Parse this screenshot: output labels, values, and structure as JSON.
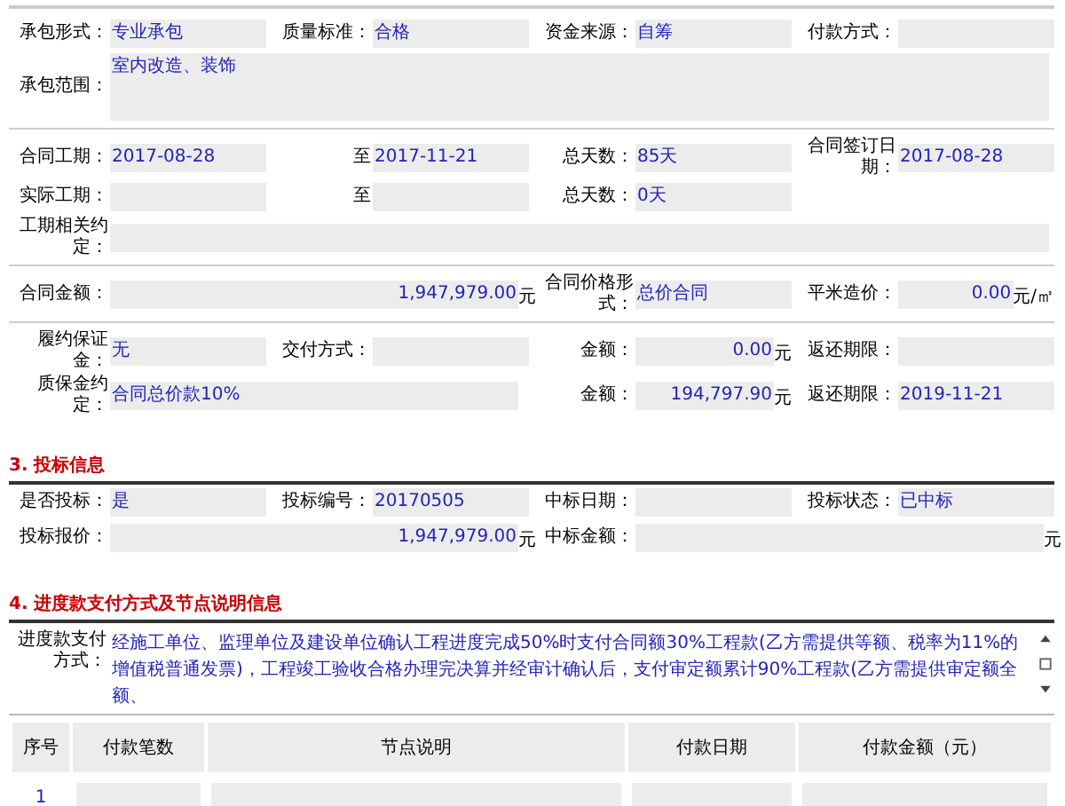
{
  "sections": [
    {
      "groups": [
        [
          [
            {
              "kind": "text",
              "label": "承包形式：",
              "value": "专业承包"
            },
            {
              "kind": "text",
              "label": "质量标准：",
              "value": "合格"
            },
            {
              "kind": "text",
              "label": "资金来源：",
              "value": "自筹"
            },
            {
              "kind": "text",
              "label": "付款方式："
            }
          ],
          [
            {
              "kind": "area",
              "label": "承包范围：",
              "value": "室内改造、装饰"
            }
          ]
        ],
        [
          [
            {
              "kind": "text",
              "label": "合同工期：",
              "value": "2017-08-28"
            },
            {
              "kind": "text",
              "label": "至",
              "value": "2017-11-21"
            },
            {
              "kind": "text",
              "label": "总天数：",
              "value": "85天"
            },
            {
              "kind": "text",
              "label": "合同签订日期：",
              "value": "2017-08-28"
            }
          ],
          [
            {
              "kind": "text",
              "label": "实际工期："
            },
            {
              "kind": "text",
              "label": "至"
            },
            {
              "kind": "text",
              "label": "总天数：",
              "value": "0天"
            }
          ],
          [
            {
              "kind": "wide",
              "label": "工期相关约定："
            }
          ]
        ],
        [
          [
            {
              "kind": "amount-half",
              "label": "合同金额：",
              "value": "1,947,979.00",
              "unit": "元"
            },
            {
              "kind": "text",
              "label": "合同价格形式：",
              "value": "总价合同"
            },
            {
              "kind": "amount",
              "label": "平米造价：",
              "value": "0.00",
              "unit": "元/㎡"
            }
          ]
        ],
        [
          [
            {
              "kind": "text",
              "label": "履约保证金：",
              "value": "无"
            },
            {
              "kind": "text",
              "label": "交付方式："
            },
            {
              "kind": "amount",
              "label": "金额：",
              "value": "0.00",
              "unit": "元"
            },
            {
              "kind": "text",
              "label": "返还期限："
            }
          ],
          [
            {
              "kind": "text-half",
              "label": "质保金约定：",
              "value": "合同总价款10%"
            },
            {
              "kind": "amount",
              "label": "金额：",
              "value": "194,797.90",
              "unit": "元"
            },
            {
              "kind": "text",
              "label": "返还期限：",
              "value": "2019-11-21"
            }
          ]
        ]
      ]
    },
    {
      "title": "3. 投标信息",
      "groups": [
        [
          [
            {
              "kind": "text",
              "label": "是否投标：",
              "value": "是"
            },
            {
              "kind": "text",
              "label": "投标编号：",
              "value": "20170505"
            },
            {
              "kind": "text",
              "label": "中标日期："
            },
            {
              "kind": "text",
              "label": "投标状态：",
              "value": "已中标"
            }
          ],
          [
            {
              "kind": "amount-half",
              "label": "投标报价：",
              "value": "1,947,979.00",
              "unit": "元"
            },
            {
              "kind": "amount-half",
              "label": "中标金额：",
              "unit": "元"
            }
          ]
        ]
      ]
    },
    {
      "title": "4. 进度款支付方式及节点说明信息",
      "payment": {
        "label": "进度款支付方式：",
        "value": "经施工单位、监理单位及建设单位确认工程进度完成50%时支付合同额30%工程款(乙方需提供等额、税率为11%的增值税普通发票)，工程竣工验收合格办理完决算并经审计确认后，支付审定额累计90%工程款(乙方需提供审定额全额、"
      },
      "table": {
        "columns": [
          "序号",
          "付款笔数",
          "节点说明",
          "付款日期",
          "付款金额（元）"
        ],
        "rows": [
          [
            "1",
            "",
            "",
            "",
            ""
          ]
        ]
      }
    }
  ]
}
